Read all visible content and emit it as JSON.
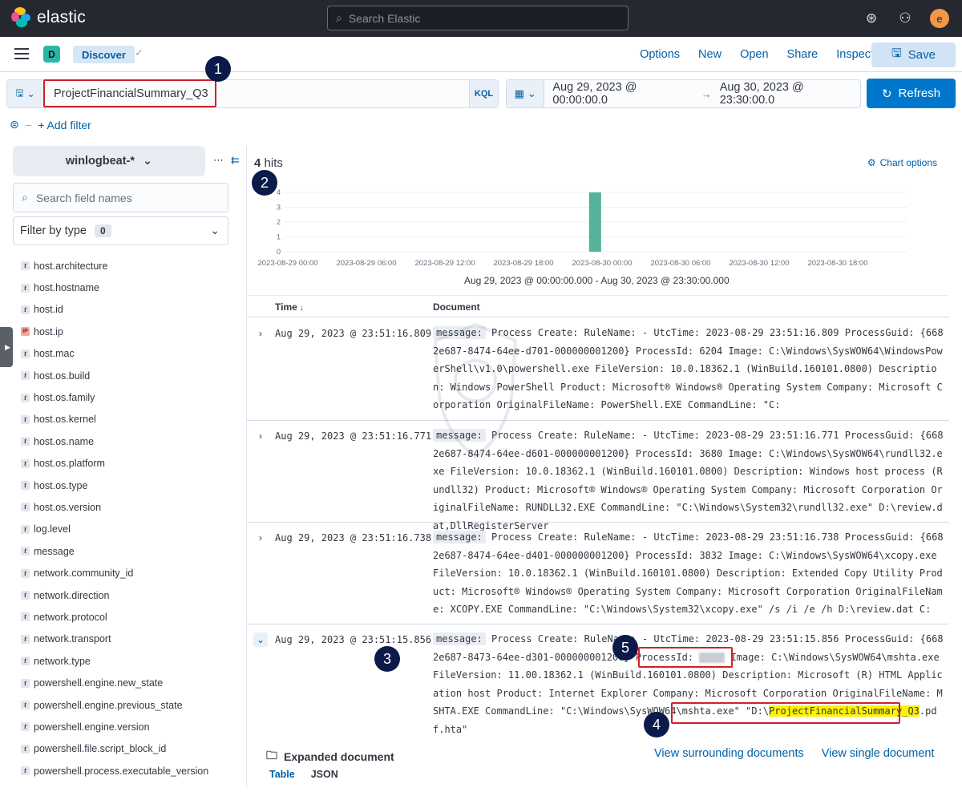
{
  "app": {
    "brand": "elastic",
    "search_placeholder": "Search Elastic",
    "avatar_letter": "e"
  },
  "nav": {
    "space_letter": "D",
    "breadcrumb": "Discover",
    "links": [
      "Options",
      "New",
      "Open",
      "Share",
      "Inspect"
    ],
    "save_label": "Save"
  },
  "query": {
    "value": "ProjectFinancialSummary_Q3",
    "language": "KQL",
    "time_start": "Aug 29, 2023 @ 00:00:00.0",
    "time_end": "Aug 30, 2023 @ 23:30:00.0",
    "refresh_label": "Refresh",
    "add_filter": "+ Add filter"
  },
  "sidebar": {
    "index_pattern": "winlogbeat-*",
    "field_search_placeholder": "Search field names",
    "filter_by_type": "Filter by type",
    "filter_count": "0",
    "fields": [
      {
        "name": "host.architecture",
        "type": "t"
      },
      {
        "name": "host.hostname",
        "type": "t"
      },
      {
        "name": "host.id",
        "type": "t"
      },
      {
        "name": "host.ip",
        "type": "IP"
      },
      {
        "name": "host.mac",
        "type": "t"
      },
      {
        "name": "host.os.build",
        "type": "t"
      },
      {
        "name": "host.os.family",
        "type": "t"
      },
      {
        "name": "host.os.kernel",
        "type": "t"
      },
      {
        "name": "host.os.name",
        "type": "t"
      },
      {
        "name": "host.os.platform",
        "type": "t"
      },
      {
        "name": "host.os.type",
        "type": "t"
      },
      {
        "name": "host.os.version",
        "type": "t"
      },
      {
        "name": "log.level",
        "type": "t"
      },
      {
        "name": "message",
        "type": "t"
      },
      {
        "name": "network.community_id",
        "type": "t"
      },
      {
        "name": "network.direction",
        "type": "t"
      },
      {
        "name": "network.protocol",
        "type": "t"
      },
      {
        "name": "network.transport",
        "type": "t"
      },
      {
        "name": "network.type",
        "type": "t"
      },
      {
        "name": "powershell.engine.new_state",
        "type": "t"
      },
      {
        "name": "powershell.engine.previous_state",
        "type": "t"
      },
      {
        "name": "powershell.engine.version",
        "type": "t"
      },
      {
        "name": "powershell.file.script_block_id",
        "type": "t"
      },
      {
        "name": "powershell.process.executable_version",
        "type": "t"
      }
    ]
  },
  "results": {
    "hits_count": "4",
    "hits_label": "hits",
    "chart_options": "Chart options",
    "range_label": "Aug 29, 2023 @ 00:00:00.000 - Aug 30, 2023 @ 23:30:00.000",
    "col_time": "Time",
    "col_document": "Document",
    "rows": [
      {
        "time": "Aug 29, 2023 @ 23:51:16.809",
        "key": "message:",
        "text": "Process Create: RuleName: - UtcTime: 2023-08-29 23:51:16.809 ProcessGuid: {6682e687-8474-64ee-d701-000000001200} ProcessId: 6204 Image: C:\\Windows\\SysWOW64\\WindowsPowerShell\\v1.0\\powershell.exe FileVersion: 10.0.18362.1 (WinBuild.160101.0800) Description: Windows PowerShell Product: Microsoft® Windows® Operating System Company: Microsoft Corporation OriginalFileName: PowerShell.EXE CommandLine: \"C:"
      },
      {
        "time": "Aug 29, 2023 @ 23:51:16.771",
        "key": "message:",
        "text": "Process Create: RuleName: - UtcTime: 2023-08-29 23:51:16.771 ProcessGuid: {6682e687-8474-64ee-d601-000000001200} ProcessId: 3680 Image: C:\\Windows\\SysWOW64\\rundll32.exe FileVersion: 10.0.18362.1 (WinBuild.160101.0800) Description: Windows host process (Rundll32) Product: Microsoft® Windows® Operating System Company: Microsoft Corporation OriginalFileName: RUNDLL32.EXE CommandLine: \"C:\\Windows\\System32\\rundll32.exe\" D:\\review.dat,DllRegisterServer"
      },
      {
        "time": "Aug 29, 2023 @ 23:51:16.738",
        "key": "message:",
        "text": "Process Create: RuleName: - UtcTime: 2023-08-29 23:51:16.738 ProcessGuid: {6682e687-8474-64ee-d401-000000001200} ProcessId: 3832 Image: C:\\Windows\\SysWOW64\\xcopy.exe FileVersion: 10.0.18362.1 (WinBuild.160101.0800) Description: Extended Copy Utility Product: Microsoft® Windows® Operating System Company: Microsoft Corporation OriginalFileName: XCOPY.EXE CommandLine: \"C:\\Windows\\System32\\xcopy.exe\" /s /i /e /h D:\\review.dat C:"
      },
      {
        "time": "Aug 29, 2023 @ 23:51:15.856",
        "key": "message:",
        "text_a": "Process Create: RuleName: - UtcTime: 2023-08-29 23:51:15.856 ProcessGuid: {6682e687-8473-64ee-d301-000000001200} ",
        "pid_label": "ProcessId:",
        "text_b": " Image: C:\\Windows\\SysWOW64\\mshta.exe FileVersion: 11.00.18362.1 (WinBuild.160101.0800) Description: Microsoft (R) HTML Application host Product: Internet Explorer Company: Microsoft Corporation OriginalFileName: MSHTA.EXE CommandLine: \"C:\\Windows\\SysWOW64\\mshta.exe\" ",
        "cmd_prefix": "\"D:\\",
        "cmd_hl": "ProjectFinancialSummary_Q3",
        "cmd_suffix": ".pdf.hta\""
      }
    ],
    "expanded_title": "Expanded document",
    "view_surrounding": "View surrounding documents",
    "view_single": "View single document",
    "tab_table": "Table",
    "tab_json": "JSON"
  },
  "annotations": [
    "1",
    "2",
    "3",
    "4",
    "5"
  ],
  "chart_data": {
    "type": "bar",
    "x_ticks": [
      "2023-08-29 00:00",
      "2023-08-29 06:00",
      "2023-08-29 12:00",
      "2023-08-29 18:00",
      "2023-08-30 00:00",
      "2023-08-30 06:00",
      "2023-08-30 12:00",
      "2023-08-30 18:00"
    ],
    "y_ticks": [
      0,
      1,
      2,
      3,
      4
    ],
    "bars": [
      {
        "x": "2023-08-29 23:30",
        "value": 4
      }
    ],
    "ylim": [
      0,
      4
    ],
    "bar_color": "#54b399",
    "grid": true
  },
  "colors": {
    "accent": "#0077cc",
    "link": "#0061a6",
    "annotation_red": "#d0202a",
    "marker_navy": "#0c1a4a"
  }
}
